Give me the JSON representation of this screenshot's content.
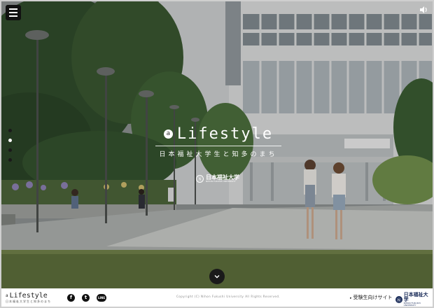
{
  "hero": {
    "title": "Lifestyle",
    "badge": "a",
    "subtitle": "日本福祉大学生と知多のまち",
    "logo_mark": "Ⓝ",
    "logo_name": "日本福祉大学",
    "logo_sub": "NIHON FUKUSHI UNIVERSITY"
  },
  "nav": {
    "dots": [
      "slide-1",
      "slide-2",
      "slide-3",
      "slide-4"
    ],
    "active_dot": 1
  },
  "footer": {
    "brand_prefix": "a",
    "brand_title": "Lifestyle",
    "brand_sub": "日本福祉大学生と知多のまち",
    "social": [
      {
        "name": "facebook",
        "glyph": "f"
      },
      {
        "name": "twitter",
        "glyph": "t"
      },
      {
        "name": "line",
        "glyph": "LINE"
      }
    ],
    "copyright": "Copyright (C) Nihon Fukushi University All Rights Reserved.",
    "exam_link": "受験生向けサイト",
    "logo_mark": "Ⓝ",
    "logo_name": "日本福祉大学",
    "logo_sub": "NIHON FUKUSHI UNIVERSITY"
  },
  "colors": {
    "footer_bg": "#ffffff",
    "menu_bg": "#111111",
    "brand_navy": "#1b2d5a"
  },
  "icons": {
    "menu": "hamburger-icon",
    "sound": "speaker-icon",
    "scroll": "chevron-down-icon"
  }
}
